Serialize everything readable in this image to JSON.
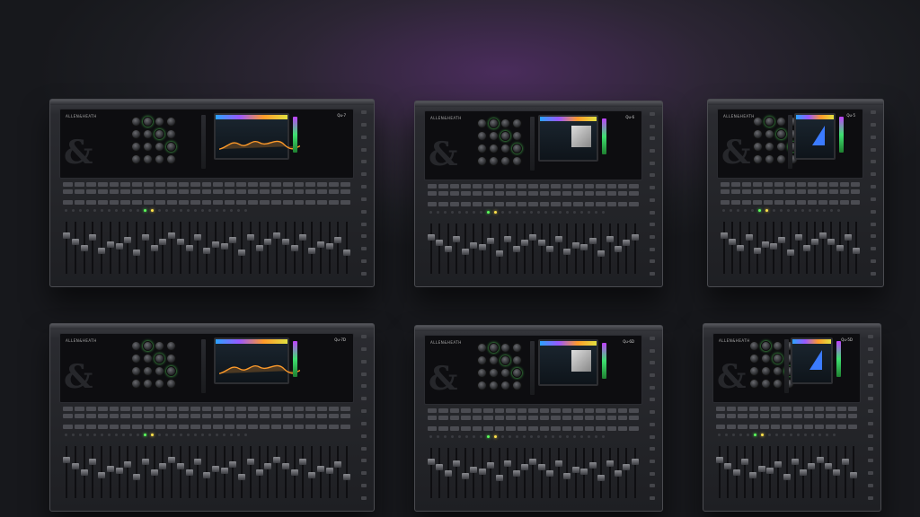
{
  "mixers": [
    {
      "name": "Qu-7",
      "brand": "ALLEN&HEATH",
      "model": "Qu-7",
      "faders": 33,
      "screen": "eq"
    },
    {
      "name": "Qu-6",
      "brand": "ALLEN&HEATH",
      "model": "Qu-6",
      "faders": 25,
      "screen": "grid"
    },
    {
      "name": "Qu-5",
      "brand": "ALLEN&HEATH",
      "model": "Qu-5",
      "faders": 17,
      "screen": "tri"
    },
    {
      "name": "Qu-7D",
      "brand": "ALLEN&HEATH",
      "model": "Qu-7D",
      "faders": 33,
      "screen": "eq"
    },
    {
      "name": "Qu-6D",
      "brand": "ALLEN&HEATH",
      "model": "Qu-6D",
      "faders": 25,
      "screen": "grid"
    },
    {
      "name": "Qu-5D",
      "brand": "ALLEN&HEATH",
      "model": "Qu-5D",
      "faders": 17,
      "screen": "tri"
    }
  ],
  "colors": {
    "accent_purple": "#4a2c5c",
    "led_green": "#5bff5b",
    "led_yellow": "#ffe24a",
    "led_blue": "#4a7dff"
  }
}
